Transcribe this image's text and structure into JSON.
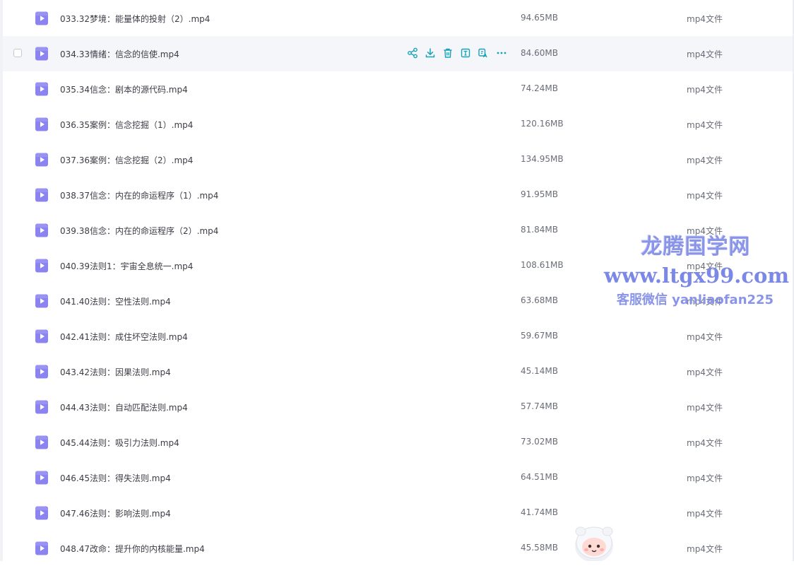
{
  "colors": {
    "accent": "#16a3b8",
    "file_icon": "#8b84f0",
    "watermark": "#8a95e8"
  },
  "row_actions": [
    {
      "icon": "share-icon"
    },
    {
      "icon": "download-icon"
    },
    {
      "icon": "delete-icon"
    },
    {
      "icon": "rename-icon"
    },
    {
      "icon": "copy-icon"
    },
    {
      "icon": "more-icon"
    }
  ],
  "files": [
    {
      "name": "033.32梦境：能量体的投射（2）.mp4",
      "size": "94.65MB",
      "type": "mp4文件"
    },
    {
      "name": "034.33情绪：信念的信使.mp4",
      "size": "84.60MB",
      "type": "mp4文件"
    },
    {
      "name": "035.34信念：剧本的源代码.mp4",
      "size": "74.24MB",
      "type": "mp4文件"
    },
    {
      "name": "036.35案例：信念挖掘（1）.mp4",
      "size": "120.16MB",
      "type": "mp4文件"
    },
    {
      "name": "037.36案例：信念挖掘（2）.mp4",
      "size": "134.95MB",
      "type": "mp4文件"
    },
    {
      "name": "038.37信念：内在的命运程序（1）.mp4",
      "size": "91.95MB",
      "type": "mp4文件"
    },
    {
      "name": "039.38信念：内在的命运程序（2）.mp4",
      "size": "81.84MB",
      "type": "mp4文件"
    },
    {
      "name": "040.39法则1：宇宙全息统一.mp4",
      "size": "108.61MB",
      "type": "mp4文件"
    },
    {
      "name": "041.40法则：空性法则.mp4",
      "size": "63.68MB",
      "type": "mp4文件"
    },
    {
      "name": "042.41法则：成住坏空法则.mp4",
      "size": "59.67MB",
      "type": "mp4文件"
    },
    {
      "name": "043.42法则：因果法则.mp4",
      "size": "45.14MB",
      "type": "mp4文件"
    },
    {
      "name": "044.43法则：自动匹配法则.mp4",
      "size": "57.74MB",
      "type": "mp4文件"
    },
    {
      "name": "045.44法则：吸引力法则.mp4",
      "size": "73.02MB",
      "type": "mp4文件"
    },
    {
      "name": "046.45法则：得失法则.mp4",
      "size": "64.51MB",
      "type": "mp4文件"
    },
    {
      "name": "047.46法则：影响法则.mp4",
      "size": "41.74MB",
      "type": "mp4文件"
    },
    {
      "name": "048.47改命：提升你的内核能量.mp4",
      "size": "45.58MB",
      "type": "mp4文件"
    }
  ],
  "watermark": {
    "title": "龙腾国学网",
    "url": "www.ltgx99.com",
    "contact": "客服微信 yanliaofan225"
  }
}
